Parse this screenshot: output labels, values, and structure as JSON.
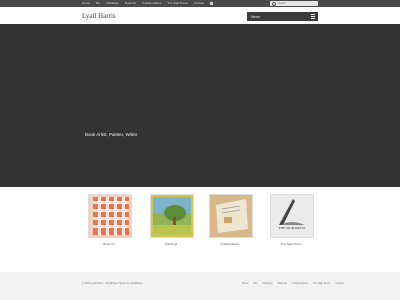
{
  "top_nav": [
    "Home",
    "Bio",
    "Paintings",
    "Book Art",
    "Collaborations",
    "The Sigh Press",
    "Contact"
  ],
  "search": {
    "placeholder": "Search"
  },
  "header": {
    "title": "Lyall Harris",
    "menu_label": "Menu"
  },
  "hero": {
    "tagline": "Book Artist, Painter, Writer"
  },
  "gallery": [
    {
      "caption": "Book Art",
      "image": "red checkered fabric"
    },
    {
      "caption": "Paintings",
      "image": "green landscape with tree"
    },
    {
      "caption": "Collaborations",
      "image": "open book"
    },
    {
      "caption": "The Sigh Press",
      "image": "The Sigh Press logo",
      "logo_text": "THE SIGH PRESS"
    }
  ],
  "footer": {
    "copyright": "© 2024 Lyall Harris · WordPress Theme by WordPress",
    "links": [
      "Home",
      "Bio",
      "Paintings",
      "Book Art",
      "Collaborations",
      "The Sigh Press",
      "Contact"
    ]
  }
}
